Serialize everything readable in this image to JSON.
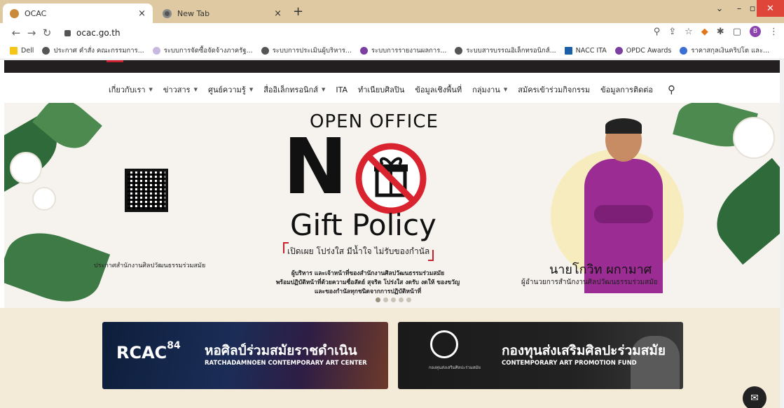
{
  "browser": {
    "tabs": [
      {
        "title": "OCAC",
        "close": "×"
      },
      {
        "title": "New Tab",
        "close": "×"
      }
    ],
    "new_tab": "+",
    "url": "ocac.go.th",
    "avatar_letter": "B",
    "bookmarks": [
      "Dell",
      "ประกาศ คำสั่ง คณะกรรมการ...",
      "ระบบการจัดซื้อจัดจ้างภาครัฐ...",
      "ระบบการประเมินผู้บริหาร...",
      "ระบบการรายงานผลการ...",
      "ระบบสารบรรณอิเล็กทรอนิกส์...",
      "NACC ITA",
      "OPDC Awards",
      "ราคาสกุลเงินคริปโต และ..."
    ]
  },
  "site": {
    "nav": [
      {
        "label": "เกี่ยวกับเรา",
        "dropdown": true
      },
      {
        "label": "ข่าวสาร",
        "dropdown": true
      },
      {
        "label": "ศูนย์ความรู้",
        "dropdown": true
      },
      {
        "label": "สื่ออิเล็กทรอนิกส์",
        "dropdown": true
      },
      {
        "label": "ITA",
        "dropdown": false
      },
      {
        "label": "ทำเนียบศิลปิน",
        "dropdown": false
      },
      {
        "label": "ข้อมูลเชิงพื้นที่",
        "dropdown": false
      },
      {
        "label": "กลุ่มงาน",
        "dropdown": true
      },
      {
        "label": "สมัครเข้าร่วมกิจกรรม",
        "dropdown": false
      },
      {
        "label": "ข้อมูลการติดต่อ",
        "dropdown": false
      }
    ],
    "hero": {
      "qr_caption": "ประกาศสำนักงานศิลปวัฒนธรรมร่วมสมัย",
      "open_office": "OPEN OFFICE",
      "big_letter": "N",
      "gift_policy": "Gift Policy",
      "slogan": "เปิดเผย โปร่งใส มีน้ำใจ ไม่รับของกำนัล",
      "desc_lines": [
        "ผู้บริหาร และเจ้าหน้าที่ของสำนักงานศิลปวัฒนธรรมร่วมสมัย",
        "พร้อมปฏิบัติหน้าที่ด้วยความซื่อสัตย์ สุจริต โปร่งใส งดรับ งดให้ ของขวัญ",
        "และของกำนัลทุกชนิดจากการปฏิบัติหน้าที่"
      ],
      "person_name": "นายโกวิท ผกามาศ",
      "person_title": "ผู้อำนวยการสำนักงานศิลปวัฒนธรรมร่วมสมัย",
      "slides_total": 5,
      "slide_active": 1
    },
    "banners": {
      "rcac": {
        "logo": "RCAC",
        "logo_num": "84",
        "thai": "หอศิลป์ร่วมสมัยราชดำเนิน",
        "english": "RATCHADAMNOEN CONTEMPORARY ART CENTER"
      },
      "fund": {
        "thai": "กองทุนส่งเสริมศิลปะร่วมสมัย",
        "english": "CONTEMPORARY ART PROMOTION FUND",
        "emblem_text": "กองทุนส่งเสริมศิลปะร่วมสมัย"
      }
    }
  }
}
